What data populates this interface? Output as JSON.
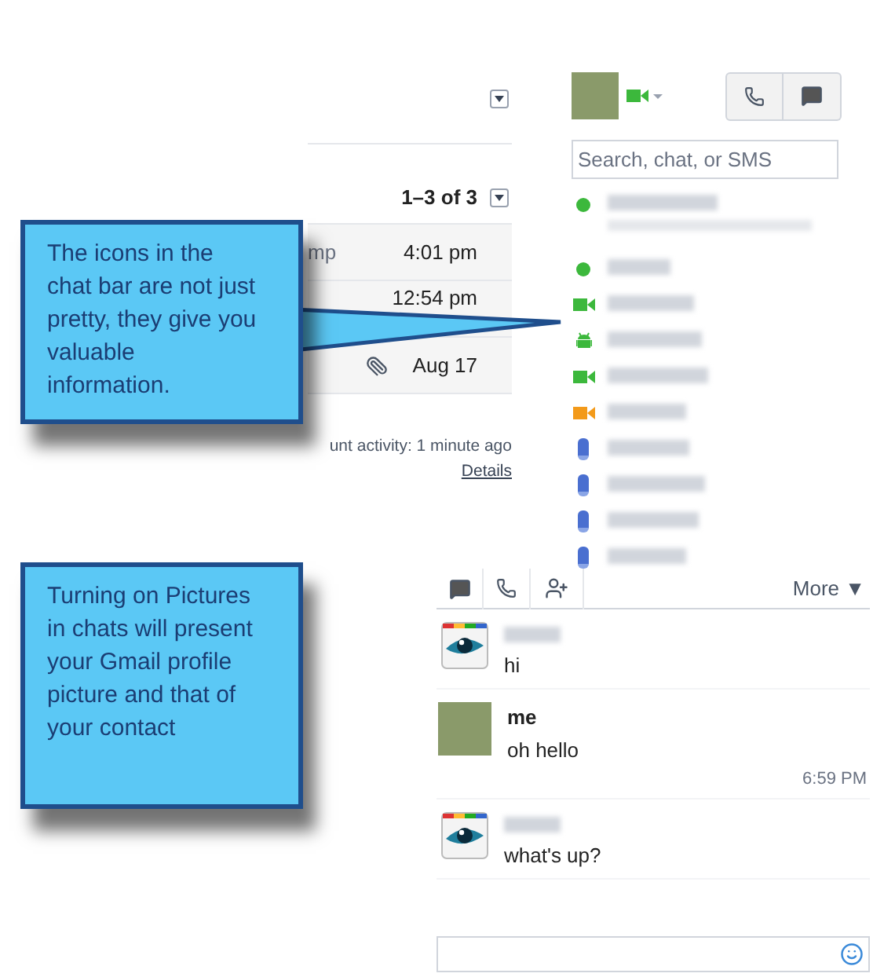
{
  "mail": {
    "pager": "1–3 of 3",
    "rows": [
      {
        "snippet": "mp",
        "time": "4:01 pm",
        "attachment": false
      },
      {
        "time": "12:54 pm",
        "attachment": false
      },
      {
        "time": "Aug 17",
        "attachment": true
      }
    ],
    "activity": "unt activity: 1 minute ago",
    "details_link": "Details"
  },
  "chat_bar": {
    "search": {
      "placeholder": "Search, chat, or SMS"
    },
    "contacts": [
      {
        "kind": "online",
        "has_status_line": true
      },
      {
        "kind": "online",
        "has_status_line": false
      },
      {
        "kind": "video",
        "has_status_line": false
      },
      {
        "kind": "android",
        "has_status_line": false
      },
      {
        "kind": "video",
        "has_status_line": false
      },
      {
        "kind": "video_idle",
        "has_status_line": false
      },
      {
        "kind": "mobile",
        "has_status_line": false
      },
      {
        "kind": "mobile",
        "has_status_line": false
      },
      {
        "kind": "mobile",
        "has_status_line": false
      },
      {
        "kind": "mobile",
        "has_status_line": false
      }
    ]
  },
  "chat_window": {
    "more": "More ▼",
    "messages": [
      {
        "kind": "contact",
        "text": "hi"
      },
      {
        "kind": "me",
        "name": "me",
        "text": "oh hello",
        "time": "6:59 PM"
      },
      {
        "kind": "contact",
        "text": "what's up?"
      }
    ]
  },
  "callouts": [
    {
      "text": "The icons in the chat bar are not just pretty, they give you valuable information."
    },
    {
      "text": "Turning on Pictures in chats will present your Gmail profile picture and that of your contact"
    }
  ]
}
